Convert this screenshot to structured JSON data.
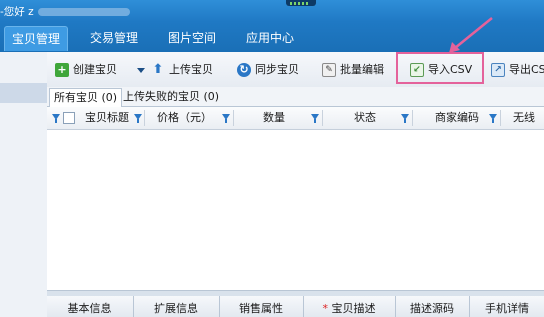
{
  "titlebar": {
    "greeting": "您好"
  },
  "nav": {
    "tabs": [
      "宝贝管理",
      "交易管理",
      "图片空间",
      "应用中心"
    ],
    "active": 0
  },
  "toolbar": {
    "create": "创建宝贝",
    "upload": "上传宝贝",
    "sync": "同步宝贝",
    "batch_edit": "批量编辑",
    "import_csv": "导入CSV",
    "export_csv": "导出CS"
  },
  "subtabs": [
    "所有宝贝 (0)",
    "上传失败的宝贝 (0)"
  ],
  "columns": [
    "宝贝标题",
    "价格（元）",
    "数量",
    "状态",
    "商家编码",
    "无线"
  ],
  "bottom_tabs": [
    "基本信息",
    "扩展信息",
    "销售属性",
    "宝贝描述",
    "描述源码",
    "手机详情"
  ],
  "colors": {
    "brand_blue": "#1f79c4",
    "highlight_pink": "#e4629b"
  }
}
